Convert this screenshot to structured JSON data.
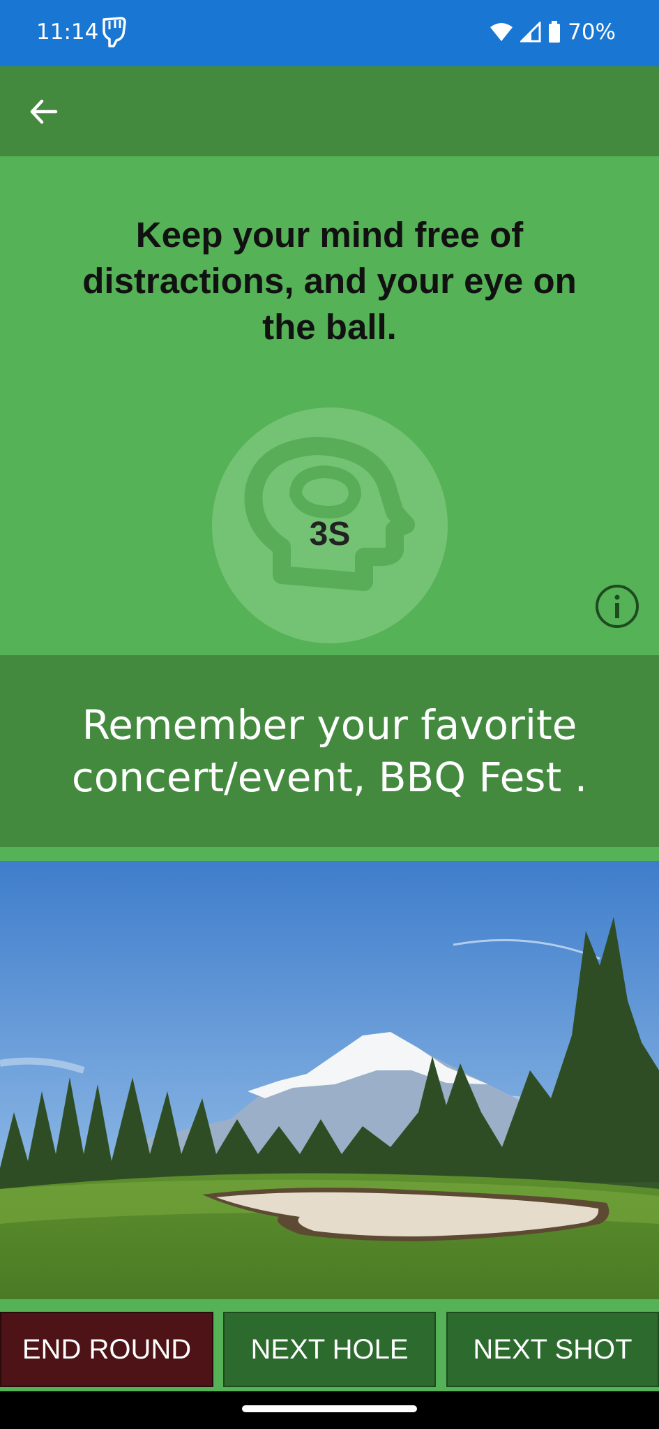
{
  "status_bar": {
    "time": "11:14",
    "battery": "70%",
    "icons": [
      "hand-icon",
      "wifi-icon",
      "signal-icon",
      "battery-icon"
    ]
  },
  "app_bar": {
    "back_icon": "arrow-left-icon"
  },
  "hero": {
    "headline": "Keep your mind free of distractions, and your eye on the ball.",
    "timer": "3S",
    "timer_icon": "head-brain-icon",
    "info_icon": "info-icon"
  },
  "prompt": {
    "text": "Remember your favorite concert/event,  BBQ Fest ."
  },
  "photo": {
    "subject": "golf-course-with-mountain"
  },
  "buttons": {
    "end_round": "END ROUND",
    "next_hole": "NEXT HOLE",
    "next_shot": "NEXT SHOT"
  },
  "colors": {
    "status_bar": "#1976d2",
    "app_bar": "#438a3f",
    "hero": "#55b257",
    "end_round": "#4d1316",
    "next_button": "#2c6a2d"
  }
}
